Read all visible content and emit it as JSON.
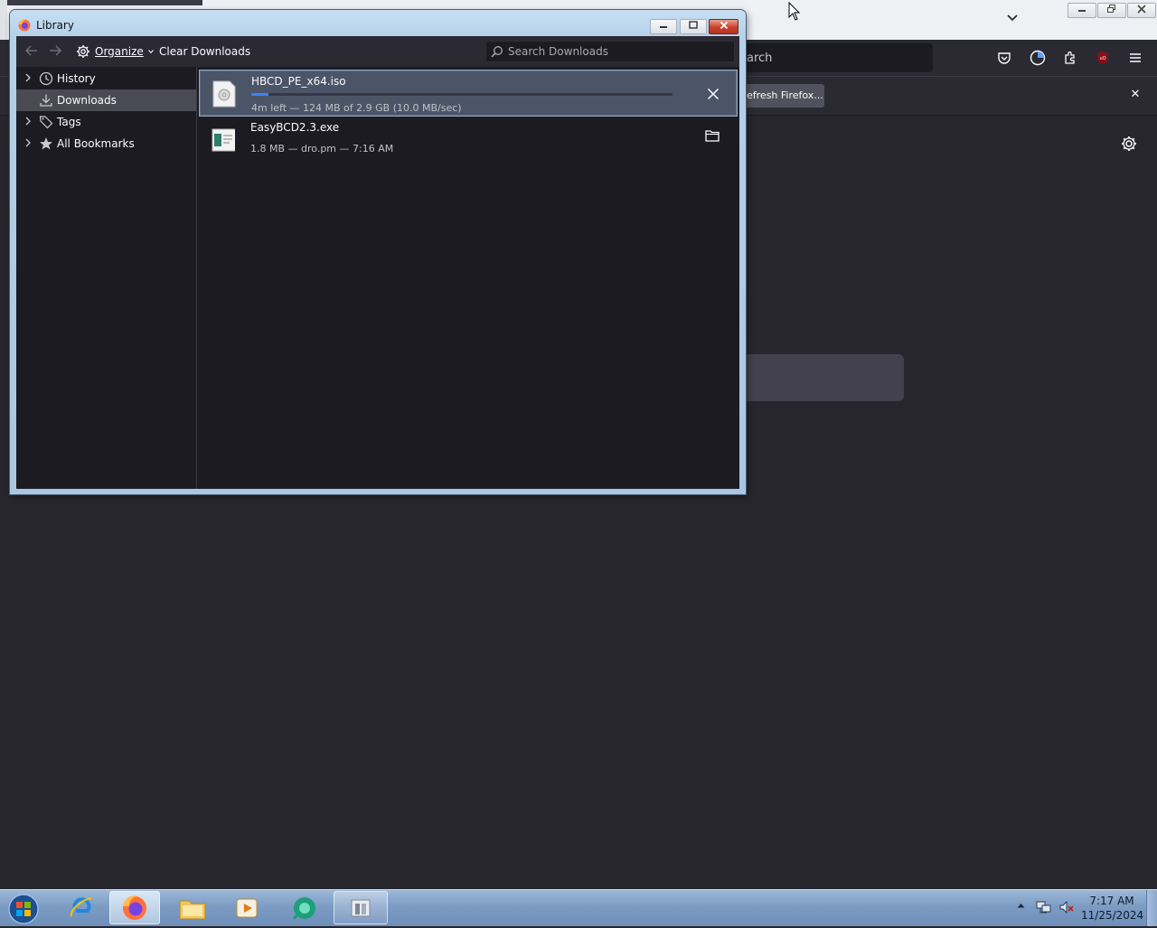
{
  "firefox": {
    "urlbar_partial_text": "arch",
    "notification_button_label": "efresh Firefox...",
    "notification_close": "✕",
    "ublock_badge": "uO"
  },
  "library": {
    "title": "Library",
    "toolbar": {
      "organize_label": "Organize",
      "clear_downloads_label": "Clear Downloads",
      "search_placeholder": "Search Downloads"
    },
    "sidebar": [
      {
        "label": "History",
        "icon": "clock-icon",
        "expandable": true,
        "selected": false
      },
      {
        "label": "Downloads",
        "icon": "download-icon",
        "expandable": false,
        "selected": true
      },
      {
        "label": "Tags",
        "icon": "tag-icon",
        "expandable": true,
        "selected": false
      },
      {
        "label": "All Bookmarks",
        "icon": "star-icon",
        "expandable": true,
        "selected": false
      }
    ],
    "downloads": [
      {
        "name": "HBCD_PE_x64.iso",
        "status": "4m left — 124 MB of 2.9 GB (10.0 MB/sec)",
        "progress_percent": 4,
        "in_progress": true,
        "action_icon": "cancel-icon"
      },
      {
        "name": "EasyBCD2.3.exe",
        "status": "1.8 MB — dro.pm — 7:16 AM",
        "in_progress": false,
        "action_icon": "folder-icon"
      }
    ]
  },
  "taskbar": {
    "clock_time": "7:17 AM",
    "clock_date": "11/25/2024",
    "apps": [
      "internet-explorer-icon",
      "firefox-icon",
      "file-explorer-icon",
      "media-player-icon",
      "app-icon",
      "library-window-icon"
    ]
  },
  "colors": {
    "accent_progress": "#3b82f6",
    "firefox_dark": "#2b2a33",
    "library_bg": "#1c1b22"
  }
}
